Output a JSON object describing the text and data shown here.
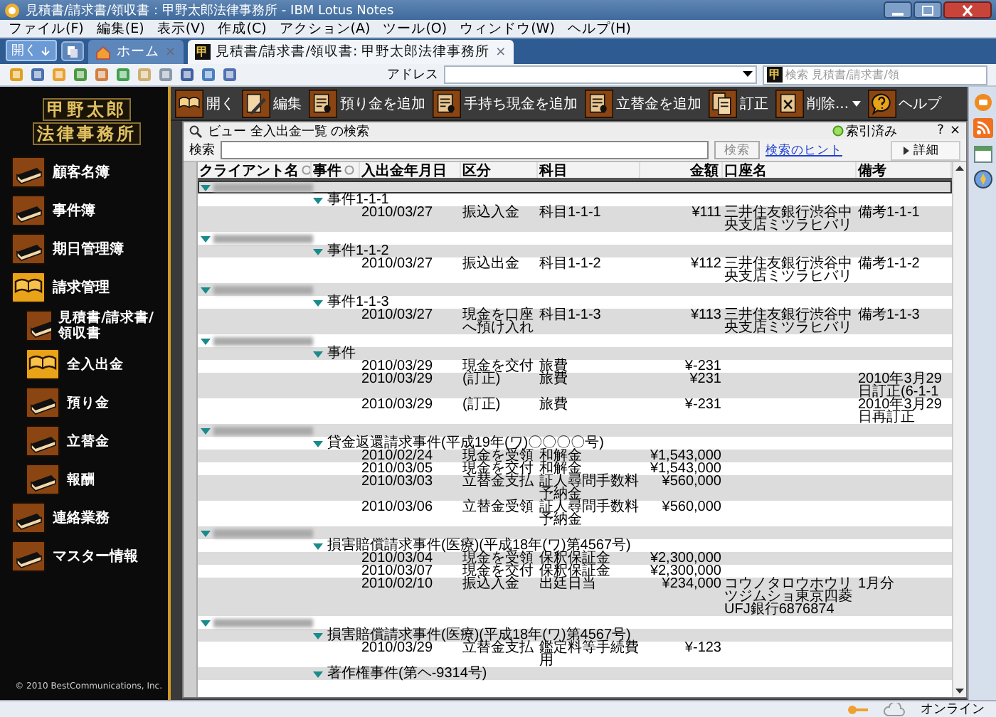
{
  "window": {
    "title": "見積書/請求書/領収書：甲野太郎法律事務所 - IBM Lotus Notes"
  },
  "menu": [
    "ファイル(F)",
    "編集(E)",
    "表示(V)",
    "作成(C)",
    "アクション(A)",
    "ツール(O)",
    "ウィンドウ(W)",
    "ヘルプ(H)"
  ],
  "tabs": {
    "open_button": "開く",
    "items": [
      {
        "kind": "home",
        "label": "ホーム",
        "selected": false,
        "close": "×"
      },
      {
        "kind": "app",
        "icon_text": "甲",
        "label": "見積書/請求書/領収書: 甲野太郎法律事務所",
        "selected": true,
        "close": "×"
      }
    ]
  },
  "toolbar": {
    "address_label": "アドレス",
    "search": {
      "icon_text": "甲",
      "placeholder": "検索 見積書/請求書/領"
    }
  },
  "sidebar": {
    "logo": [
      "甲野太郎",
      "法律事務所"
    ],
    "items": [
      {
        "label": "顧客名簿",
        "selected": false
      },
      {
        "label": "事件簿",
        "selected": false
      },
      {
        "label": "期日管理簿",
        "selected": false
      },
      {
        "label": "請求管理",
        "selected": true,
        "children": [
          {
            "label": "見積書/請求書/領収書",
            "selected": false
          },
          {
            "label": "全入出金",
            "selected": true
          },
          {
            "label": "預り金",
            "selected": false
          },
          {
            "label": "立替金",
            "selected": false
          },
          {
            "label": "報酬",
            "selected": false
          }
        ]
      },
      {
        "label": "連絡業務",
        "selected": false
      },
      {
        "label": "マスター情報",
        "selected": false
      }
    ],
    "copyright": "© 2010 BestCommunications, Inc."
  },
  "actions": [
    {
      "kind": "book",
      "label": "開く"
    },
    {
      "kind": "pencil",
      "label": "編集"
    },
    {
      "kind": "ledger",
      "label": "預り金を追加"
    },
    {
      "kind": "ledger",
      "label": "手持ち現金を追加"
    },
    {
      "kind": "ledger",
      "label": "立替金を追加"
    },
    {
      "kind": "copy",
      "label": "訂正"
    },
    {
      "kind": "menu",
      "label": "削除..."
    },
    {
      "kind": "help",
      "label": "ヘルプ"
    }
  ],
  "view": {
    "title": "ビュー 全入出金一覧 の検索",
    "index_status": "索引済み",
    "help": "?",
    "close": "×",
    "search": {
      "label": "検索",
      "button": "検索",
      "hint_link": "検索のヒント",
      "details_button": "詳細"
    },
    "columns": [
      {
        "label": "クライアント名",
        "sortable": true
      },
      {
        "label": "事件",
        "sortable": true
      },
      {
        "label": "入出金年月日",
        "sortable": false
      },
      {
        "label": "区分",
        "sortable": false
      },
      {
        "label": "科目",
        "sortable": false
      },
      {
        "label": "金額",
        "sortable": false
      },
      {
        "label": "口座名",
        "sortable": false
      },
      {
        "label": "備考",
        "sortable": false
      }
    ],
    "rows": [
      {
        "expanded": true,
        "selected": true,
        "children": [
          {
            "label": "事件1-1-1",
            "expanded": true,
            "children": [
              {
                "date": "2010/03/27",
                "type": "振込入金",
                "subject": "科目1-1-1",
                "amount": "¥111",
                "account": "三井住友銀行渋谷中央支店ミツラヒバリ",
                "note": "備考1-1-1"
              }
            ]
          }
        ]
      },
      {
        "expanded": true,
        "selected": false,
        "children": [
          {
            "label": "事件1-1-2",
            "expanded": true,
            "children": [
              {
                "date": "2010/03/27",
                "type": "振込出金",
                "subject": "科目1-1-2",
                "amount": "¥112",
                "account": "三井住友銀行渋谷中央支店ミツラヒバリ",
                "note": "備考1-1-2"
              }
            ]
          }
        ]
      },
      {
        "expanded": true,
        "selected": false,
        "children": [
          {
            "label": "事件1-1-3",
            "expanded": true,
            "children": [
              {
                "date": "2010/03/27",
                "type": "現金を口座へ預け入れ",
                "subject": "科目1-1-3",
                "amount": "¥113",
                "account": "三井住友銀行渋谷中央支店ミツラヒバリ",
                "note": "備考1-1-3"
              }
            ]
          }
        ]
      },
      {
        "expanded": true,
        "selected": false,
        "children": [
          {
            "label": "事件",
            "expanded": true,
            "children": [
              {
                "date": "2010/03/29",
                "type": "現金を交付",
                "subject": "旅費",
                "amount": "¥-231"
              },
              {
                "date": "2010/03/29",
                "type": "(訂正)",
                "subject": "旅費",
                "amount": "¥231",
                "note": "2010年3月29日訂正(6-1-1"
              },
              {
                "date": "2010/03/29",
                "type": "(訂正)",
                "subject": "旅費",
                "amount": "¥-231",
                "note": "2010年3月29日再訂正"
              }
            ]
          }
        ]
      },
      {
        "expanded": true,
        "selected": false,
        "children": [
          {
            "label": "貸金返還請求事件(平成19年(ワ)〇〇〇〇号)",
            "expanded": true,
            "children": [
              {
                "date": "2010/02/24",
                "type": "現金を受領",
                "subject": "和解金",
                "amount": "¥1,543,000"
              },
              {
                "date": "2010/03/05",
                "type": "現金を交付",
                "subject": "和解金",
                "amount": "¥1,543,000"
              },
              {
                "date": "2010/03/03",
                "type": "立替金支払",
                "subject": "証人尋問手数料予納金",
                "amount": "¥560,000"
              },
              {
                "date": "2010/03/06",
                "type": "立替金受領",
                "subject": "証人尋問手数料予納金",
                "amount": "¥560,000"
              }
            ]
          }
        ]
      },
      {
        "expanded": true,
        "selected": false,
        "children": [
          {
            "label": "損害賠償請求事件(医療)(平成18年(ワ)第4567号)",
            "expanded": true,
            "children": [
              {
                "date": "2010/03/04",
                "type": "現金を受領",
                "subject": "保釈保証金",
                "amount": "¥2,300,000"
              },
              {
                "date": "2010/03/07",
                "type": "現金を交付",
                "subject": "保釈保証金",
                "amount": "¥2,300,000"
              },
              {
                "date": "2010/02/10",
                "type": "振込入金",
                "subject": "出廷日当",
                "amount": "¥234,000",
                "account": "コウノタロウホウリツジムショ東京四菱UFJ銀行6876874",
                "note": "1月分"
              }
            ]
          }
        ]
      },
      {
        "expanded": true,
        "selected": false,
        "children": [
          {
            "label": "損害賠償請求事件(医療)(平成18年(ワ)第4567号)",
            "expanded": true,
            "children": [
              {
                "date": "2010/03/29",
                "type": "立替金支払",
                "subject": "鑑定料等手続費用",
                "amount": "¥-123"
              }
            ]
          },
          {
            "label": "著作権事件(第ヘ-9314号)",
            "expanded": true
          }
        ]
      }
    ]
  },
  "status_bar": {
    "online": "オンライン"
  }
}
